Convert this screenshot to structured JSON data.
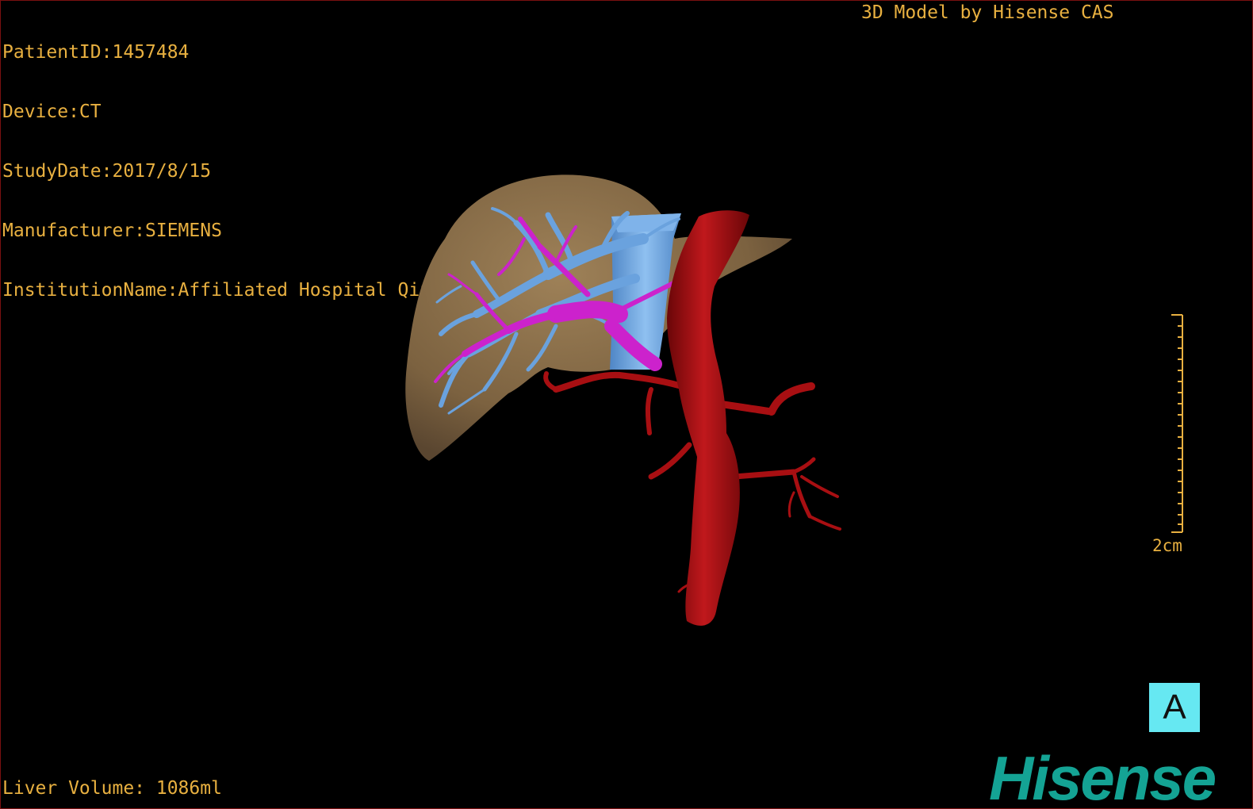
{
  "overlay": {
    "patient_id": "PatientID:1457484",
    "device": "Device:CT",
    "study_date": "StudyDate:2017/8/15",
    "manufacturer": "Manufacturer:SIEMENS",
    "institution": "InstitutionName:Affiliated Hospital Qingdao University-C",
    "model_credit": "3D Model by Hisense CAS",
    "liver_volume": "Liver Volume: 1086ml"
  },
  "scale_bar": {
    "label": "2cm"
  },
  "orientation": {
    "label": "A"
  },
  "logo": {
    "text": "Hisense"
  },
  "colors": {
    "overlay_text": "#e8b040",
    "liver": "#8a6e48",
    "portal_vein": "#6aa2de",
    "hepatic_vein": "#cc22cc",
    "artery": "#a80f12",
    "orientation_cube": "#66e8f2",
    "logo": "#14a394",
    "border": "#7a1010"
  }
}
